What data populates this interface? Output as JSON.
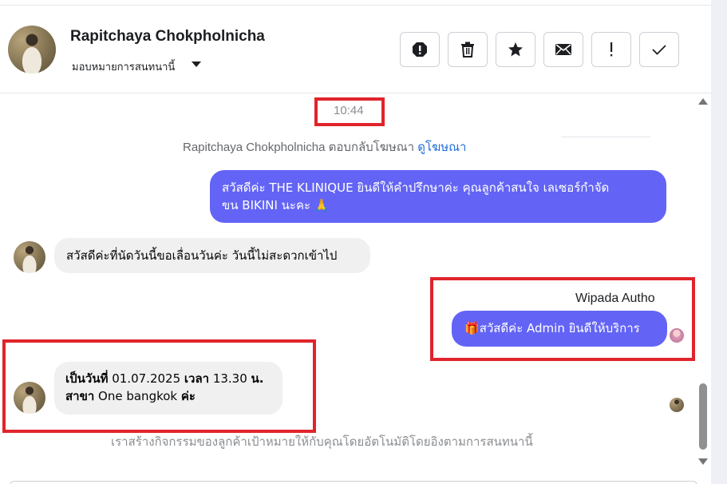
{
  "header": {
    "contact_name": "Rapitchaya Chokpholnicha",
    "assign_label": "มอบหมายการสนทนานี้",
    "toolbar": [
      {
        "name": "spam-button",
        "icon": "alert-circle-icon"
      },
      {
        "name": "delete-button",
        "icon": "trash-icon"
      },
      {
        "name": "star-button",
        "icon": "star-icon"
      },
      {
        "name": "mark-unread-button",
        "icon": "envelope-icon"
      },
      {
        "name": "follow-up-button",
        "icon": "exclamation-icon"
      },
      {
        "name": "mark-done-button",
        "icon": "check-icon"
      }
    ]
  },
  "chat": {
    "timestamp": "10:44",
    "reply_note": {
      "text": "Rapitchaya Chokpholnicha ตอบกลับโฆษณา ",
      "link": "ดูโฆษณา"
    },
    "messages": [
      {
        "dir": "out",
        "text_line1": "สวัสดีค่ะ THE KLINIQUE  ยินดีให้คำปรึกษาค่ะ คุณลูกค้าสนใจ เลเซอร์กำจัด",
        "text_line2": "ขน BIKINI นะคะ 🙏"
      },
      {
        "dir": "in",
        "text": "สวัสดีค่ะที่นัดวันนี้ขอเลื่อนวันค่ะ วันนี้ไม่สะดวกเข้าไป"
      },
      {
        "dir": "out",
        "sender": "Wipada Autho",
        "emoji": "🎁",
        "text": "สวัสดีค่ะ Admin ยินดีให้บริการ"
      },
      {
        "dir": "in",
        "line1_bold": "เป็นวันที่",
        "line1_rest": " 01.07.2025  ",
        "line1_bold2": "เวลา",
        "line1_rest2": " 13.30 ",
        "line1_bold3": "น.",
        "line2_bold": "สาขา",
        "line2_rest": " One bangkok ",
        "line2_bold2": "ค่ะ"
      }
    ],
    "footer_note": "เราสร้างกิจกรรมของลูกค้าเป้าหมายให้กับคุณโดยอัตโนมัติโดยอิงตามการสนทนานี้"
  },
  "colors": {
    "outgoing_bubble": "#6364f5",
    "incoming_bubble": "#f0f0f0",
    "highlight_box": "#e0242b",
    "link": "#216fdb"
  }
}
